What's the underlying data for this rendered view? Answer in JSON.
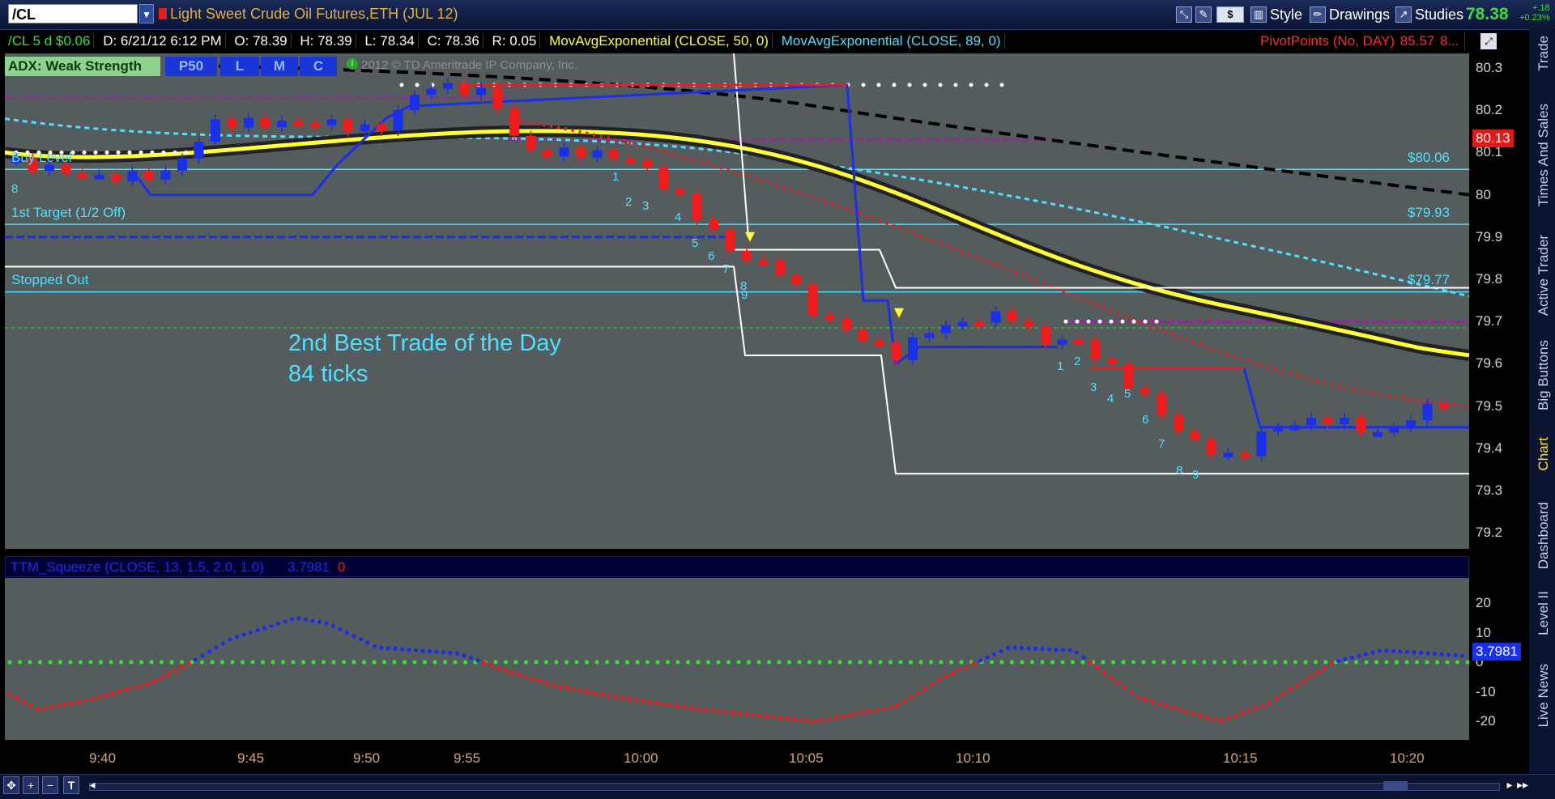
{
  "header": {
    "symbol": "/CL",
    "title": "Light Sweet Crude Oil Futures,ETH (JUL 12)",
    "tools": {
      "style": "Style",
      "drawings": "Drawings",
      "studies": "Studies",
      "dollar": "$"
    },
    "last_price": "78.38",
    "change_abs": "+.18",
    "change_pct": "+0.23%"
  },
  "infobar": {
    "agg": "/CL 5 d $0.06",
    "date": "D: 6/21/12 6:12 PM",
    "open": "O: 78.39",
    "high": "H: 78.39",
    "low": "L: 78.34",
    "close": "C: 78.36",
    "range": "R: 0.05",
    "ema50": "MovAvgExponential (CLOSE, 50, 0)",
    "ema89": "MovAvgExponential (CLOSE, 89, 0)",
    "pivot": "PivotPoints (No, DAY)",
    "pivot_val": "85.57",
    "pivot_more": "8..."
  },
  "upper": {
    "adx": "ADX:  Weak Strength",
    "buttons": [
      "P50",
      "L",
      "M",
      "C"
    ],
    "copyright": "2012 © TD Ameritrade IP Company, Inc.",
    "price_ticks": [
      "80.3",
      "80.2",
      "80.1",
      "80",
      "79.9",
      "79.8",
      "79.7",
      "79.6",
      "79.5",
      "79.4",
      "79.3",
      "79.2"
    ],
    "last_badge": "80.13",
    "levels": [
      {
        "label": "Buy Level",
        "value": "$80.06"
      },
      {
        "label": "1st Target (1/2 Off)",
        "value": "$79.93"
      },
      {
        "label": "Stopped Out",
        "value": "$79.77"
      }
    ],
    "annotation": [
      "2nd Best Trade of the Day",
      "84 ticks"
    ],
    "seq_left": [
      "8",
      "1",
      "2",
      "3",
      "4",
      "5",
      "6",
      "7",
      "8",
      "9"
    ],
    "seq_right": [
      "1",
      "2",
      "3",
      "4",
      "5",
      "6",
      "7",
      "8",
      "9"
    ]
  },
  "lower": {
    "study": "TTM_Squeeze (CLOSE, 13, 1.5, 2.0, 1.0)",
    "value": "3.7981",
    "alert": "0",
    "ticks": [
      "20",
      "10",
      "0",
      "-10",
      "-20"
    ],
    "badge": "3.7981"
  },
  "time_ticks": [
    "9:40",
    "9:45",
    "9:50",
    "9:55",
    "10:00",
    "10:05",
    "10:10",
    "10:15",
    "10:20"
  ],
  "right_tabs": [
    "Trade",
    "Times And Sales",
    "Active Trader",
    "Big Buttons",
    "Chart",
    "Dashboard",
    "Level II",
    "Live News"
  ],
  "colors": {
    "up": "#1a2fe8",
    "down": "#ee1c1c",
    "ema50": "#ffff3a",
    "ema89": "#4fe0ff",
    "pivot": "#ff2a2a",
    "level": "#4fe0ff",
    "background": "#555c5d"
  }
}
